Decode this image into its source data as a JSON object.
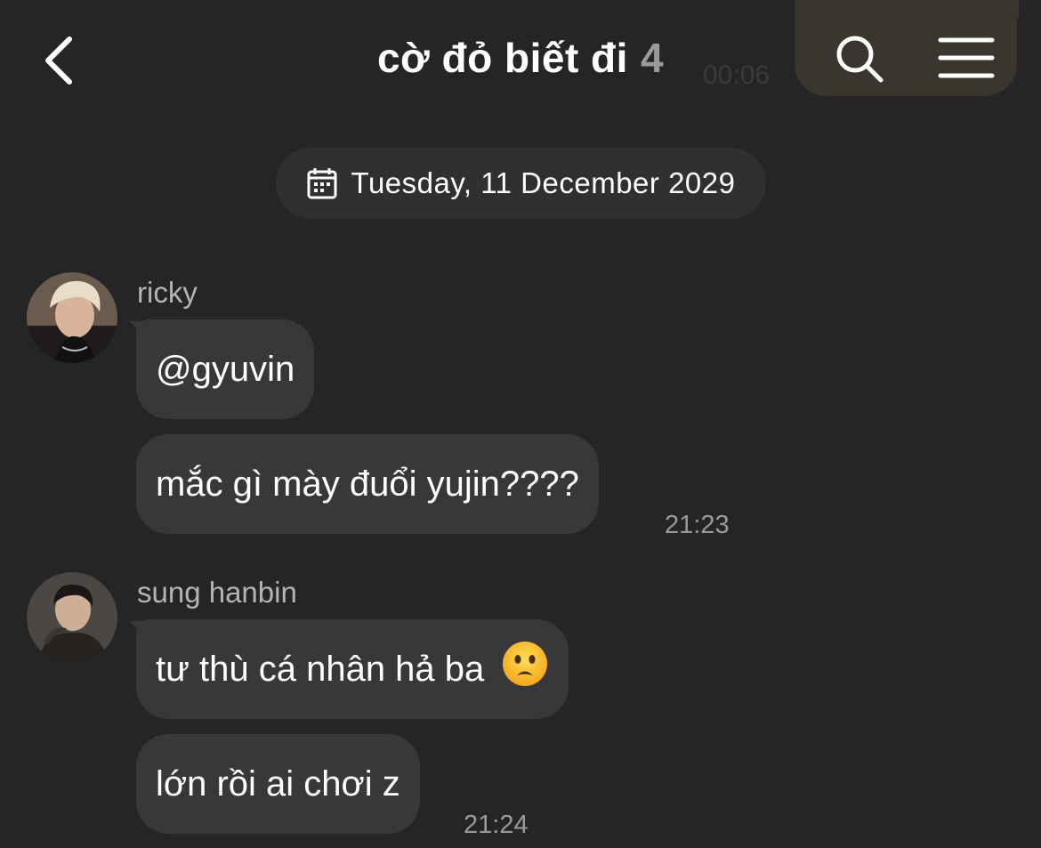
{
  "header": {
    "title": "cờ đỏ biết đi",
    "member_count": "4",
    "ghost_time": "00:06"
  },
  "date_separator": "Tuesday, 11 December 2029",
  "messages": [
    {
      "sender": "ricky",
      "bubbles": [
        "@gyuvin",
        "mắc gì mày đuổi yujin????"
      ],
      "time": "21:23"
    },
    {
      "sender": "sung hanbin",
      "bubbles": [
        "tư thù cá nhân hả ba",
        "lớn rồi ai chơi z"
      ],
      "emoji": "frowning-face",
      "time": "21:24"
    }
  ],
  "colors": {
    "background": "#252527",
    "bubble": "#38383b",
    "date_chip": "#303033",
    "action_pill": "#3a352f",
    "secondary_text": "#9a9a9c"
  },
  "icons": [
    "back-chevron-icon",
    "search-icon",
    "menu-icon",
    "calendar-icon"
  ]
}
